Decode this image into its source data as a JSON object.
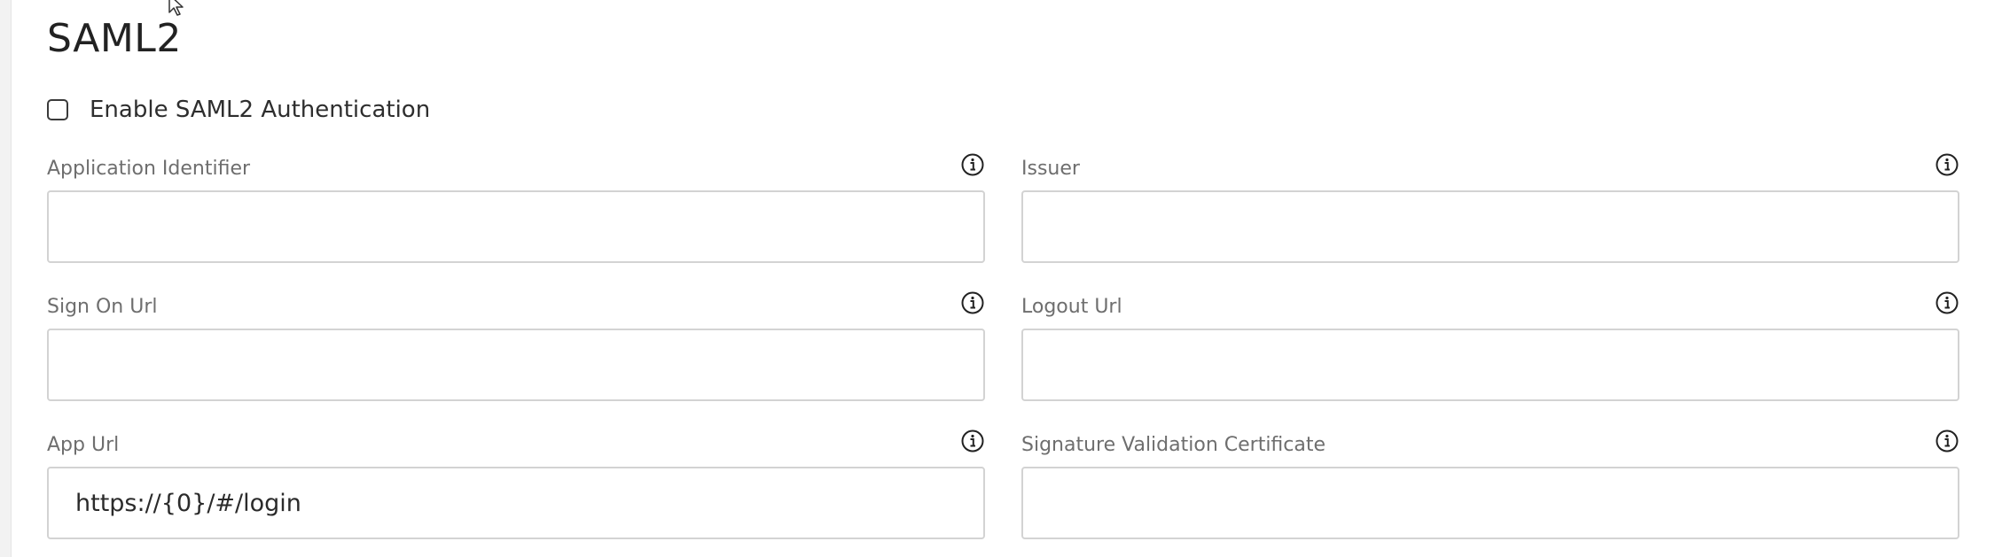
{
  "section": {
    "title": "SAML2"
  },
  "enable": {
    "label": "Enable SAML2 Authentication",
    "checked": false
  },
  "fields": {
    "application_identifier": {
      "label": "Application Identifier",
      "value": "",
      "icon": "info-icon"
    },
    "issuer": {
      "label": "Issuer",
      "value": "",
      "icon": "info-icon"
    },
    "sign_on_url": {
      "label": "Sign On Url",
      "value": "",
      "icon": "info-icon"
    },
    "logout_url": {
      "label": "Logout Url",
      "value": "",
      "icon": "info-icon"
    },
    "app_url": {
      "label": "App Url",
      "value": "https://{0}/#/login",
      "icon": "info-icon"
    },
    "signature_validation_certificate": {
      "label": "Signature Validation Certificate",
      "value": "",
      "icon": "info-icon"
    }
  },
  "colors": {
    "border": "#d3d3d3",
    "label": "#6e6e6e",
    "text": "#2b2b2b"
  }
}
